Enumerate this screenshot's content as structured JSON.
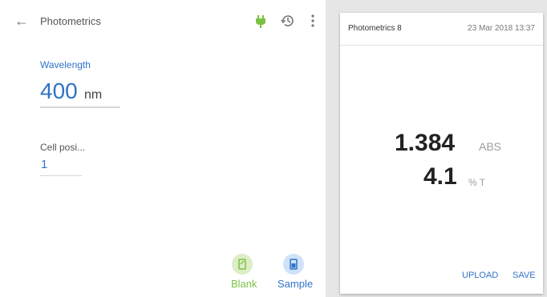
{
  "header": {
    "back_icon": "arrow-left-icon",
    "title": "Photometrics"
  },
  "toolbar": {
    "power_icon": "plug-icon",
    "history_icon": "history-icon",
    "more_icon": "more-vert-icon",
    "power_color": "#7cc242"
  },
  "form": {
    "wavelength": {
      "label": "Wavelength",
      "value": "400",
      "unit": "nm"
    },
    "cell_position": {
      "label": "Cell posi...",
      "value": "1"
    }
  },
  "actions": {
    "blank": {
      "label": "Blank",
      "icon": "blank-cuvette-icon",
      "color": "#7cc242"
    },
    "sample": {
      "label": "Sample",
      "icon": "sample-cuvette-icon",
      "color": "#2f73c7"
    }
  },
  "result_card": {
    "title": "Photometrics 8",
    "date": "23 Mar 2018 13:37",
    "abs_value": "1.384",
    "abs_unit": "ABS",
    "t_value": "4.1",
    "t_unit": "% T",
    "upload_label": "UPLOAD",
    "save_label": "SAVE"
  }
}
